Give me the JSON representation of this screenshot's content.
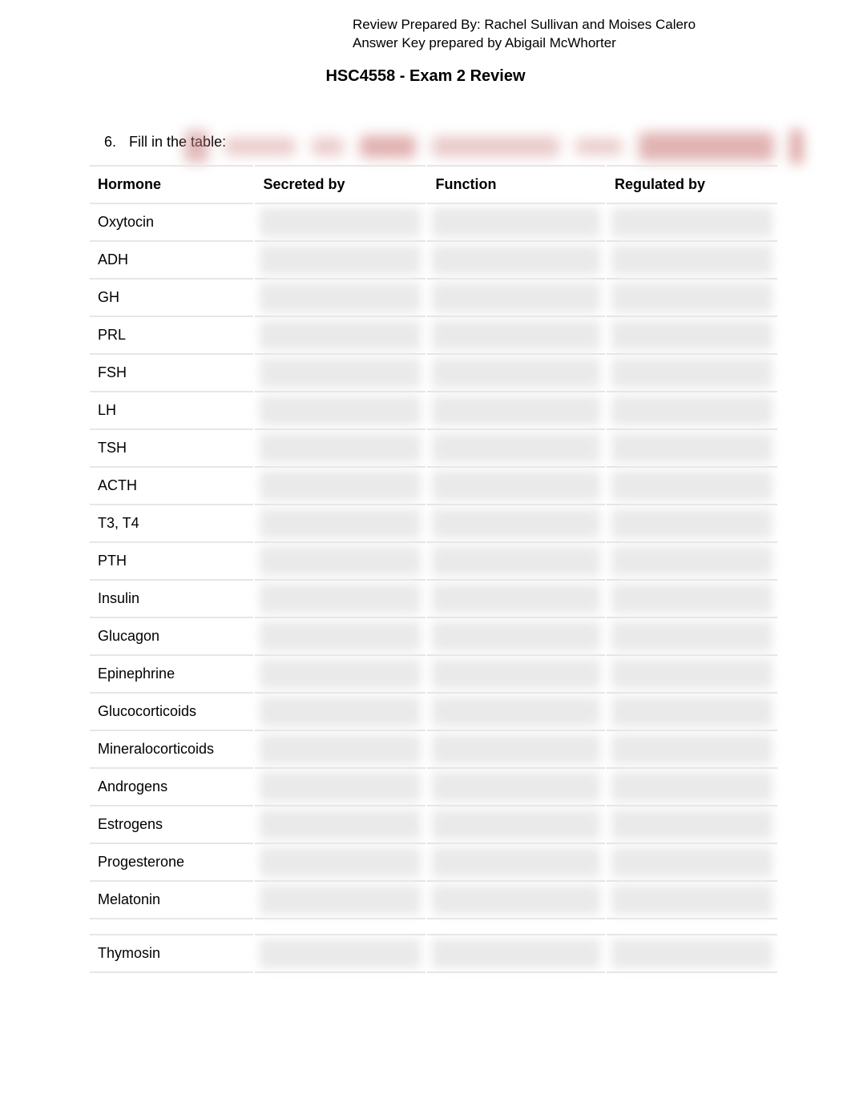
{
  "meta": {
    "line1": "Review Prepared By: Rachel Sullivan and Moises Calero",
    "line2": "Answer Key prepared by Abigail McWhorter"
  },
  "title": "HSC4558 - Exam 2 Review",
  "question": {
    "number": "6.",
    "text": "Fill in the table:"
  },
  "table": {
    "headers": {
      "hormone": "Hormone",
      "secreted_by": "Secreted by",
      "function": "Function",
      "regulated_by": "Regulated by"
    },
    "rows": [
      {
        "hormone": "Oxytocin"
      },
      {
        "hormone": "ADH"
      },
      {
        "hormone": "GH"
      },
      {
        "hormone": "PRL"
      },
      {
        "hormone": "FSH"
      },
      {
        "hormone": "LH"
      },
      {
        "hormone": "TSH"
      },
      {
        "hormone": "ACTH"
      },
      {
        "hormone": "T3, T4"
      },
      {
        "hormone": "PTH"
      },
      {
        "hormone": "Insulin"
      },
      {
        "hormone": "Glucagon"
      },
      {
        "hormone": "Epinephrine"
      },
      {
        "hormone": "Glucocorticoids"
      },
      {
        "hormone": "Mineralocorticoids"
      },
      {
        "hormone": "Androgens"
      },
      {
        "hormone": "Estrogens"
      },
      {
        "hormone": "Progesterone"
      },
      {
        "hormone": "Melatonin"
      }
    ],
    "rows2": [
      {
        "hormone": "Thymosin"
      }
    ]
  }
}
